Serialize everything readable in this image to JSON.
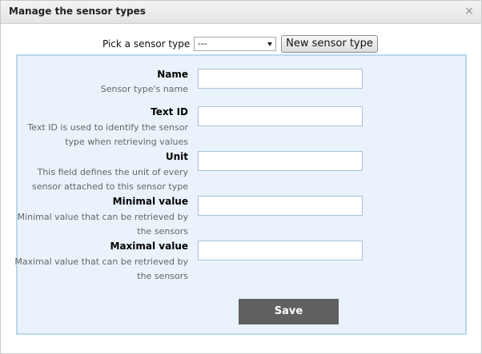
{
  "dialog": {
    "title": "Manage the sensor types",
    "close_icon": "×"
  },
  "picker": {
    "label": "Pick a sensor type :",
    "selected": "---",
    "new_button": "New sensor type"
  },
  "fields": [
    {
      "label": "Name",
      "description": "Sensor type's name"
    },
    {
      "label": "Text ID",
      "description": "Text ID is used to identify the sensor type when retrieving values"
    },
    {
      "label": "Unit",
      "description": "This field defines the unit of every sensor attached to this sensor type"
    },
    {
      "label": "Minimal value",
      "description": "Minimal value that can be retrieved by the sensors"
    },
    {
      "label": "Maximal value",
      "description": "Maximal value that can be retrieved by the sensors"
    }
  ],
  "save_button": "Save",
  "colors": {
    "panel_bg": "#eaf2fb",
    "panel_border": "#b9d9ee",
    "save_bg": "#606060"
  }
}
